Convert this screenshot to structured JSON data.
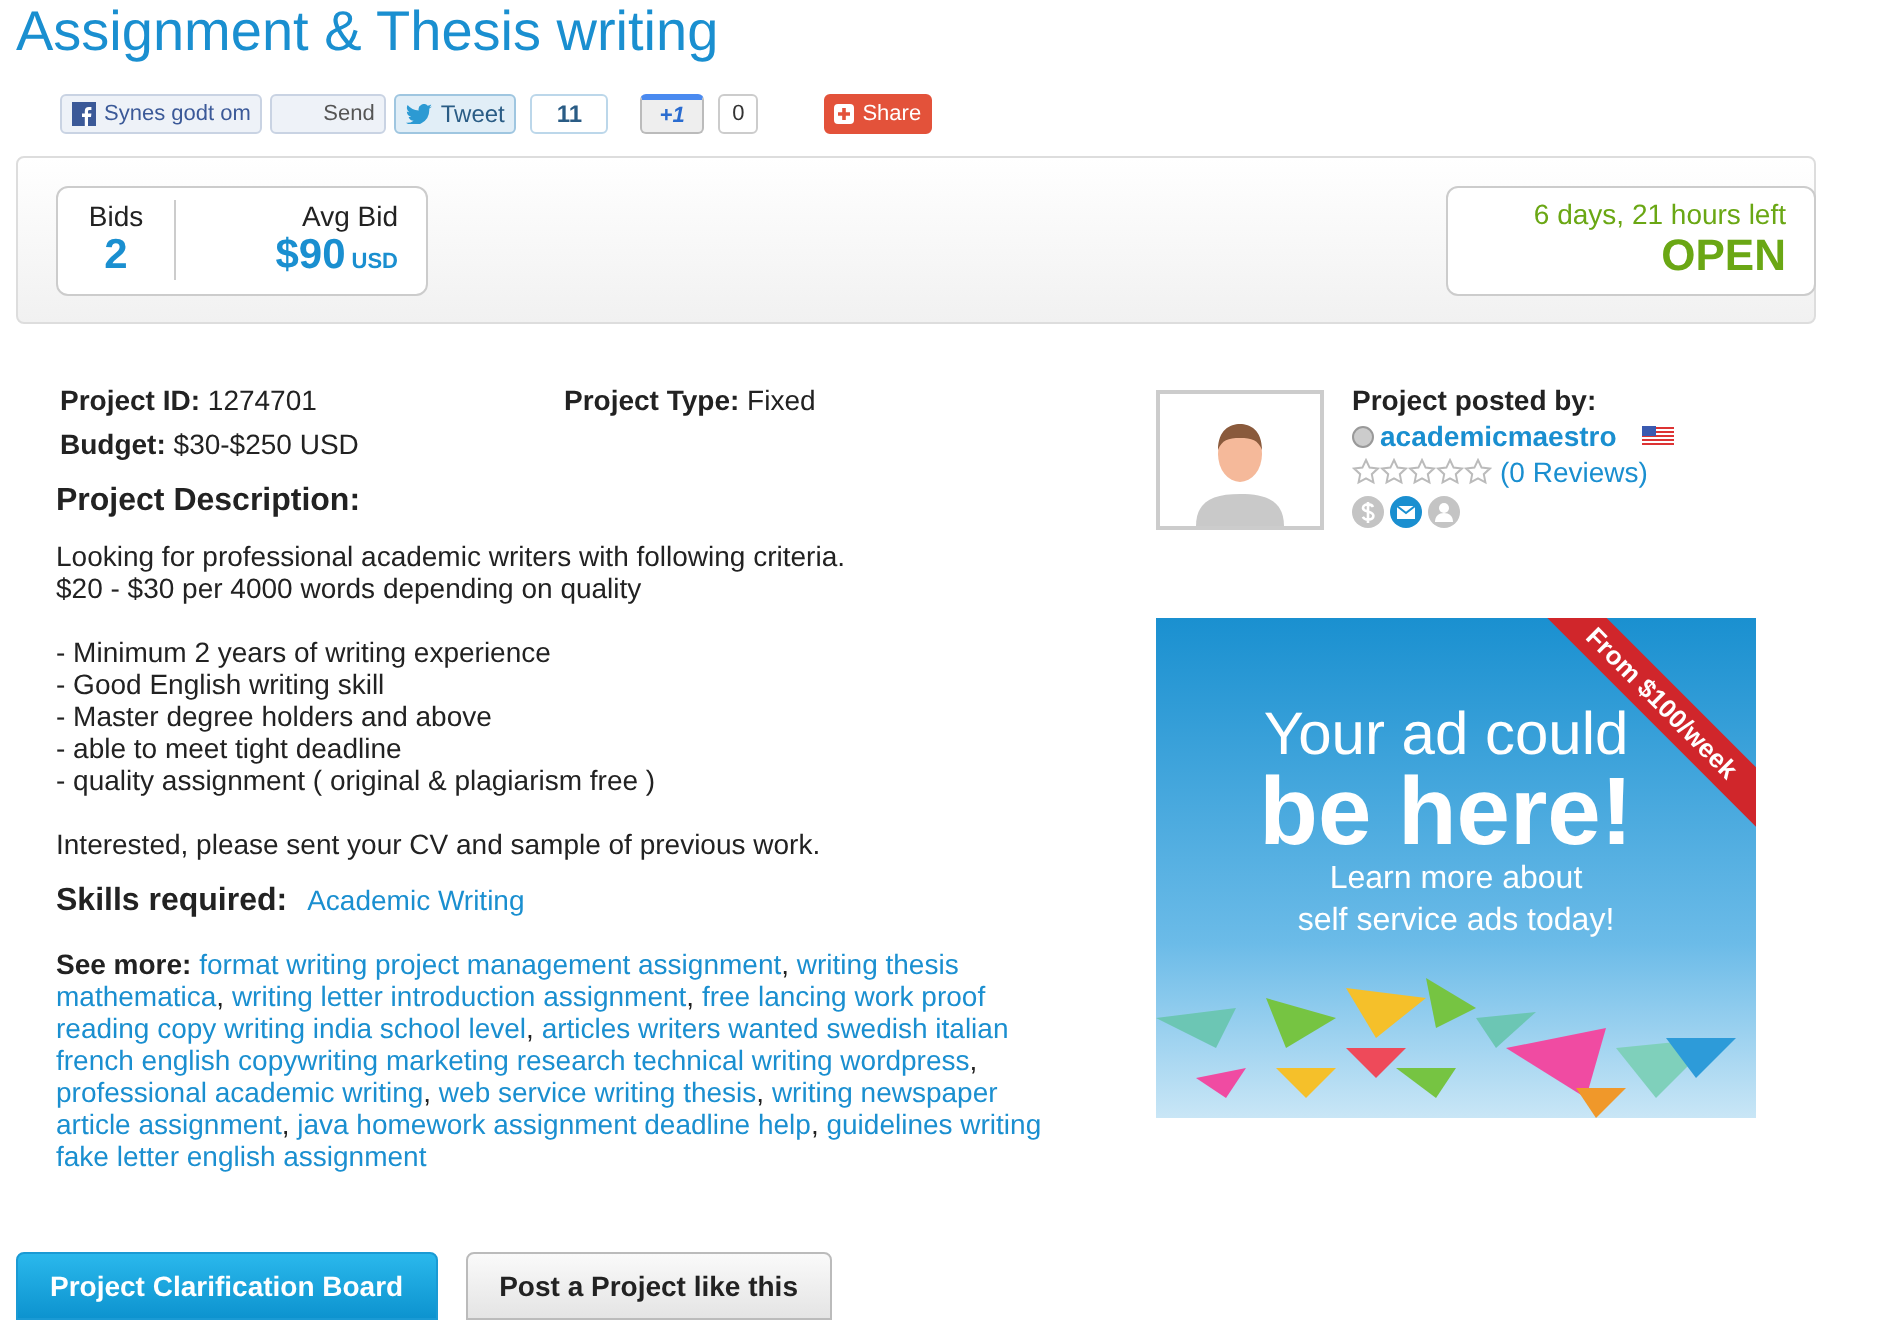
{
  "title": "Assignment & Thesis writing",
  "social": {
    "like": "Synes godt om",
    "send": "Send",
    "tweet": "Tweet",
    "tweet_count": "11",
    "plusone": "+1",
    "plusone_count": "0",
    "share": "Share"
  },
  "stats": {
    "bids_label": "Bids",
    "bids": "2",
    "avg_label": "Avg Bid",
    "avg": "$90",
    "currency": "USD",
    "time_left": "6 days, 21 hours left",
    "status": "OPEN"
  },
  "details": {
    "id_label": "Project ID:",
    "id": "1274701",
    "type_label": "Project Type:",
    "type": "Fixed",
    "budget_label": "Budget:",
    "budget": "$30-$250 USD"
  },
  "description": {
    "heading": "Project Description:",
    "paragraphs": [
      [
        "Looking for professional academic writers with following criteria.",
        "$20 - $30 per 4000 words depending on quality"
      ],
      [
        "- Minimum 2 years of writing experience",
        "- Good English writing skill",
        "- Master degree holders and above",
        "- able to meet tight deadline",
        "- quality assignment ( original & plagiarism free )"
      ],
      [
        "Interested, please sent your CV and sample of previous work."
      ]
    ]
  },
  "skills": {
    "label": "Skills required:",
    "items": [
      "Academic Writing"
    ]
  },
  "see_more": {
    "label": "See more:",
    "separator": ",",
    "links": [
      "format writing project management assignment",
      "writing thesis mathematica",
      "writing letter introduction assignment",
      "free lancing work proof reading copy writing india school level",
      "articles writers wanted swedish italian french english copywriting marketing research technical writing wordpress",
      "professional academic writing",
      "web service writing thesis",
      "writing newspaper article assignment",
      "java homework assignment deadline help",
      "guidelines writing fake letter english assignment"
    ]
  },
  "poster": {
    "heading": "Project posted by:",
    "username": "academicmaestro",
    "stars": 0,
    "reviews": "(0 Reviews)",
    "badges": [
      {
        "kind": "payment",
        "verified": false
      },
      {
        "kind": "email",
        "verified": true
      },
      {
        "kind": "profile",
        "verified": false
      }
    ]
  },
  "ad": {
    "ribbon": "From $100/week",
    "headline_1": "Your ad could",
    "headline_2": "be here!",
    "subline_1": "Learn more about",
    "subline_2": "self service ads today!"
  },
  "tabs": [
    {
      "label": "Project Clarification Board",
      "selected": true
    },
    {
      "label": "Post a Project like this",
      "selected": false
    }
  ]
}
